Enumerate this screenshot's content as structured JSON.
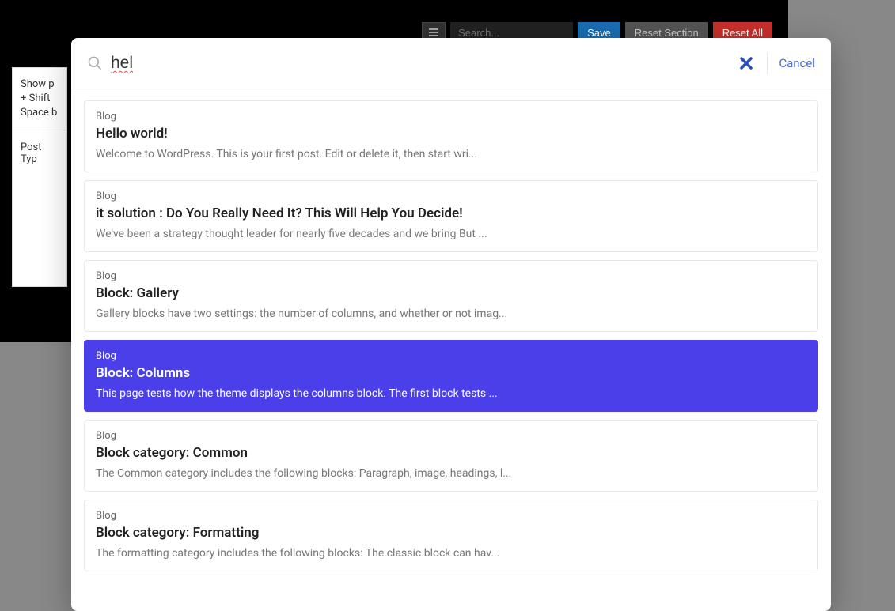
{
  "toolbar": {
    "search_placeholder": "Search...",
    "save_label": "Save",
    "reset_section_label": "Reset Section",
    "reset_all_label": "Reset All"
  },
  "sidebar": {
    "line1": "Show p",
    "line2": "+ Shift",
    "line3": "Space b",
    "line4": "Post Typ"
  },
  "modal": {
    "search_value": "hel",
    "cancel_label": "Cancel",
    "results": [
      {
        "category": "Blog",
        "title": "Hello world!",
        "excerpt": "Welcome to WordPress. This is your first post. Edit or delete it, then start wri..."
      },
      {
        "category": "Blog",
        "title": "it solution : Do You Really Need It? This Will Help You Decide!",
        "excerpt": "We've been a strategy thought leader for nearly five decades and we bring But ..."
      },
      {
        "category": "Blog",
        "title": "Block: Gallery",
        "excerpt": "Gallery blocks have two settings: the number of columns, and whether or not imag..."
      },
      {
        "category": "Blog",
        "title": "Block: Columns",
        "excerpt": "This page tests how the theme displays the columns block. The first block tests ..."
      },
      {
        "category": "Blog",
        "title": "Block category: Common",
        "excerpt": "The Common category includes the following blocks: Paragraph, image, headings, l..."
      },
      {
        "category": "Blog",
        "title": "Block category: Formatting",
        "excerpt": "The formatting category includes the following blocks: The classic block can hav..."
      }
    ],
    "active_index": 3
  }
}
